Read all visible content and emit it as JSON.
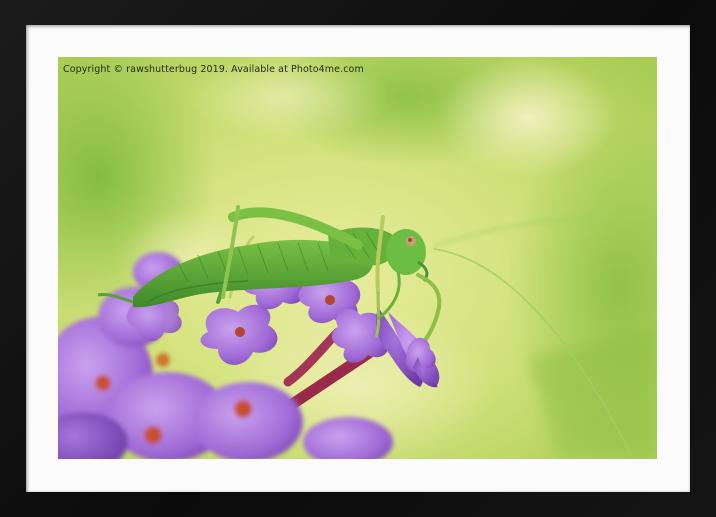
{
  "copyright": "Copyright  © rawshutterbug  2019. Available at Photo4me.com",
  "colors": {
    "frame": "#111111",
    "mat": "#fbfbfb",
    "background_light": "#dfe98f",
    "background_green": "#8cbf3a",
    "insect_green": "#55a235",
    "flower_purple": "#a86bd6",
    "flower_center": "#c8502a"
  }
}
